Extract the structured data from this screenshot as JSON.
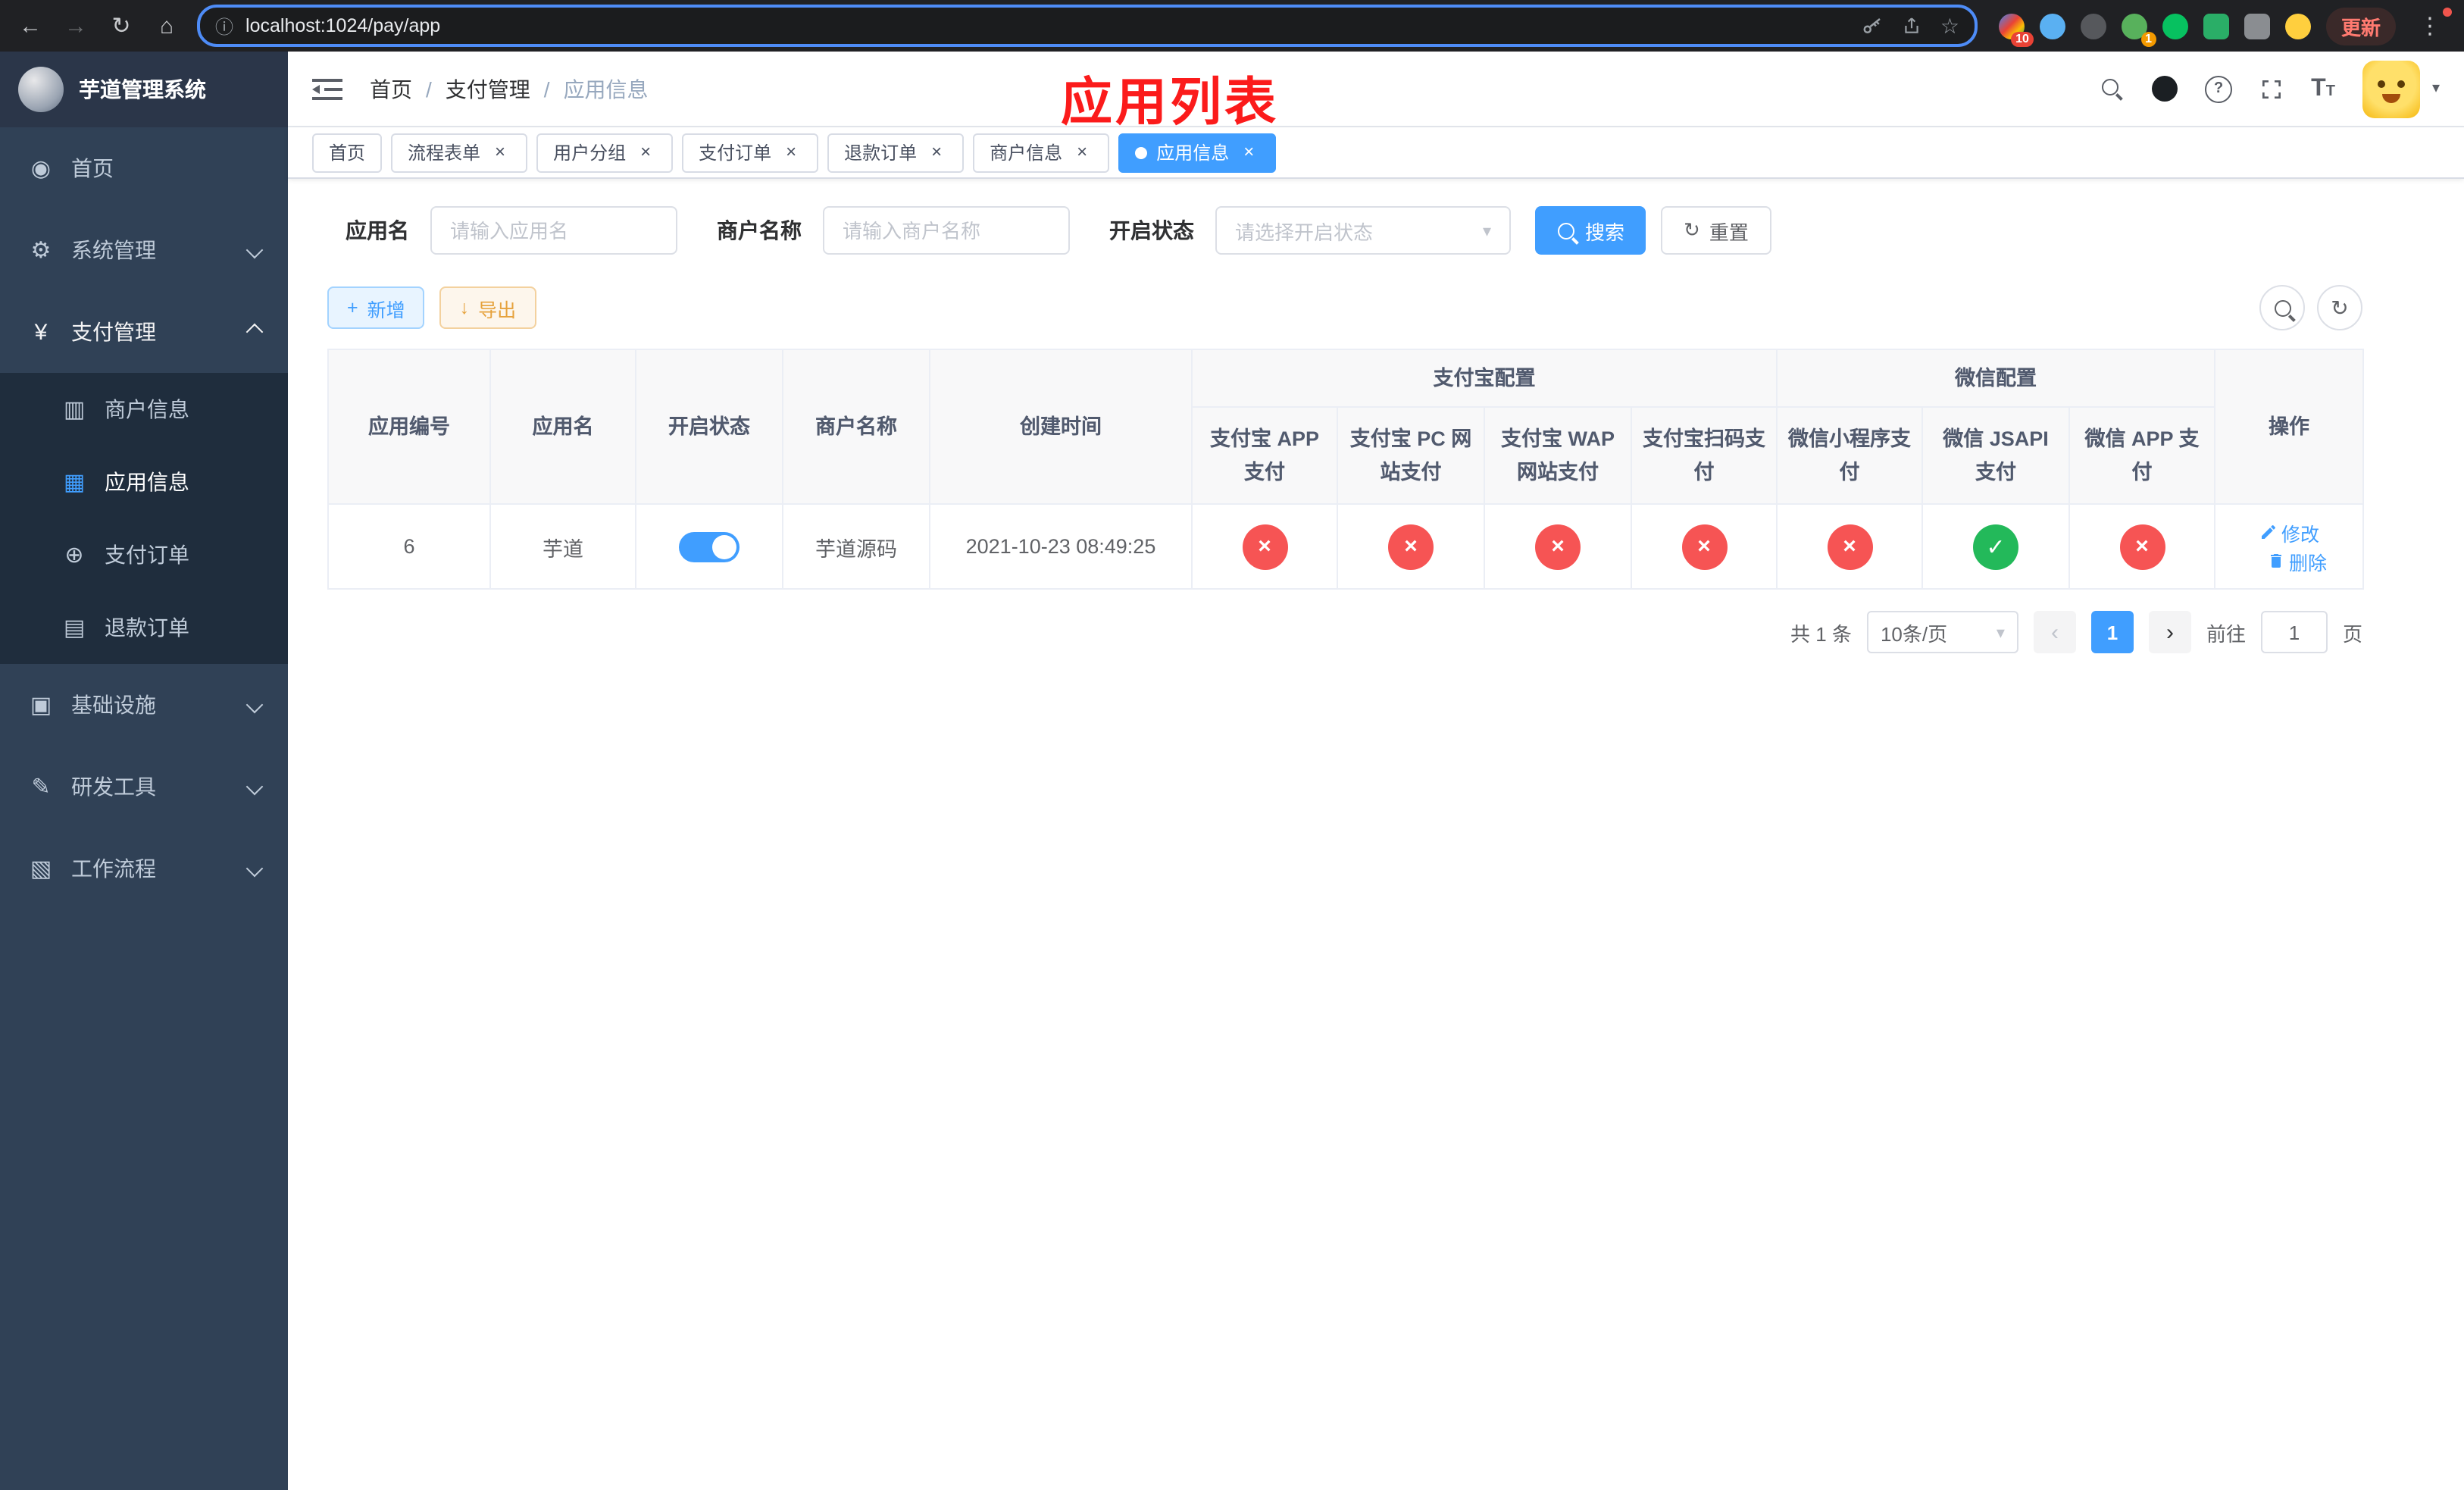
{
  "browser": {
    "url": "localhost:1024/pay/app",
    "update_label": "更新",
    "ext_badge_1": "10",
    "ext_badge_2": "1"
  },
  "icons": {
    "back": "←",
    "forward": "→",
    "reload": "↻",
    "home": "⌂",
    "info": "ⓘ",
    "star": "☆",
    "dots": "⋮",
    "dashboard": "◉",
    "gear": "⚙",
    "yen": "¥",
    "merchant": "▥",
    "app": "▦",
    "order": "⊕",
    "refund": "▤",
    "infra": "▣",
    "devtools": "✎",
    "workflow": "▧",
    "question": "?",
    "fontsize_big": "T",
    "fontsize_small": "T",
    "caret": "▾",
    "plus": "+",
    "download": "↓",
    "refresh": "↻",
    "dropdown": "▾",
    "close": "×",
    "check": "✓",
    "cross": "×",
    "prev": "‹",
    "next": "›"
  },
  "colors": {
    "primary": "#409eff",
    "success": "#23b95a",
    "danger": "#f65454",
    "warning": "#e6a23c",
    "sidebar_bg": "#304156",
    "submenu_bg": "#1f2d3d",
    "annotation_red": "#fb1b1b"
  },
  "sidebar": {
    "title": "芋道管理系统",
    "items": [
      "首页",
      "系统管理",
      "支付管理",
      "基础设施",
      "研发工具",
      "工作流程"
    ],
    "submenu": [
      "商户信息",
      "应用信息",
      "支付订单",
      "退款订单"
    ]
  },
  "header": {
    "breadcrumb": [
      "首页",
      "支付管理",
      "应用信息"
    ],
    "separator": "/",
    "annotation": "应用列表"
  },
  "tabs": [
    {
      "label": "首页"
    },
    {
      "label": "流程表单"
    },
    {
      "label": "用户分组"
    },
    {
      "label": "支付订单"
    },
    {
      "label": "退款订单"
    },
    {
      "label": "商户信息"
    },
    {
      "label": "应用信息"
    }
  ],
  "filters": {
    "app_name_label": "应用名",
    "app_name_placeholder": "请输入应用名",
    "merchant_label": "商户名称",
    "merchant_placeholder": "请输入商户名称",
    "status_label": "开启状态",
    "status_placeholder": "请选择开启状态",
    "search_label": "搜索",
    "reset_label": "重置"
  },
  "toolbar": {
    "add_label": "新增",
    "export_label": "导出"
  },
  "table": {
    "plain_columns": [
      "应用编号",
      "应用名",
      "开启状态",
      "商户名称",
      "创建时间"
    ],
    "alipay_group": {
      "label": "支付宝配置",
      "columns": [
        "支付宝 APP 支付",
        "支付宝 PC 网站支付",
        "支付宝 WAP 网站支付",
        "支付宝扫码支付"
      ]
    },
    "wechat_group": {
      "label": "微信配置",
      "columns": [
        "微信小程序支付",
        "微信 JSAPI 支付",
        "微信 APP 支付"
      ]
    },
    "action_column": "操作",
    "row": {
      "id": "6",
      "name": "芋道",
      "status_on": true,
      "merchant": "芋道源码",
      "created": "2021-10-23 08:49:25",
      "statuses": [
        false,
        false,
        false,
        false,
        false,
        true,
        false
      ],
      "edit_label": "修改",
      "delete_label": "删除"
    }
  },
  "pagination": {
    "total_text": "共 1 条",
    "page_size": "10条/页",
    "current_page": "1",
    "goto_prefix": "前往",
    "goto_value": "1",
    "goto_suffix": "页"
  }
}
